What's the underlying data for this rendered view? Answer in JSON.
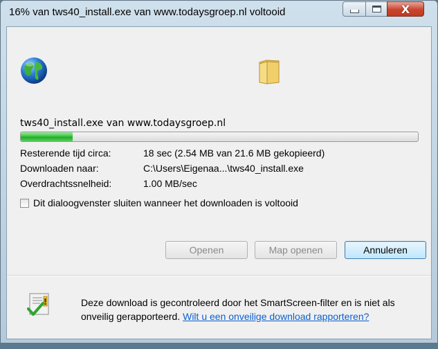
{
  "window": {
    "title": "16% van tws40_install.exe van www.todaysgroep.nl voltooid",
    "close_glyph": "X"
  },
  "download": {
    "file_label": "tws40_install.exe van www.todaysgroep.nl",
    "progress": 0.13,
    "rows": [
      {
        "label": "Resterende tijd circa:",
        "value": "18 sec (2.54 MB van 21.6 MB gekopieerd)"
      },
      {
        "label": "Downloaden naar:",
        "value": "C:\\Users\\Eigenaa...\\tws40_install.exe"
      },
      {
        "label": "Overdrachtssnelheid:",
        "value": "1.00 MB/sec"
      }
    ],
    "close_when_done_label": "Dit dialoogvenster sluiten wanneer het downloaden is voltooid",
    "close_when_done_checked": false
  },
  "buttons": {
    "open": "Openen",
    "open_folder": "Map openen",
    "cancel": "Annuleren"
  },
  "footer": {
    "message": "Deze download is gecontroleerd door het SmartScreen-filter en is niet als onveilig gerapporteerd.",
    "link": "Wilt u een onveilige download rapporteren?"
  },
  "icons": {
    "globe": "globe-icon",
    "folder": "folder-icon",
    "shield": "smartscreen-shield-icon"
  },
  "colors": {
    "progress_green": "#37c83c",
    "link": "#0a5fd0",
    "close_button": "#c9452f"
  }
}
